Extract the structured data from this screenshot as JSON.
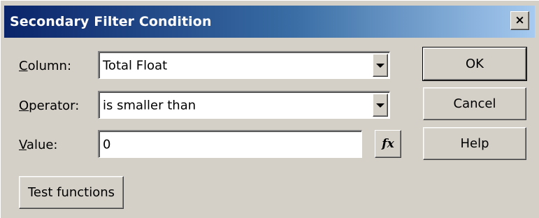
{
  "window": {
    "title": "Secondary Filter Condition",
    "close_glyph": "×"
  },
  "fields": {
    "column": {
      "label_accel": "C",
      "label_rest": "olumn:",
      "value": "Total Float"
    },
    "operator": {
      "label_accel": "O",
      "label_rest": "perator:",
      "value": "is smaller than"
    },
    "value": {
      "label_accel": "V",
      "label_rest": "alue:",
      "value": "0"
    }
  },
  "buttons": {
    "ok": "OK",
    "cancel": "Cancel",
    "help": "Help",
    "test_functions": "Test functions",
    "fx": "fx"
  },
  "icons": {
    "close": "close-icon",
    "dropdown": "chevron-down-icon",
    "function": "function-icon"
  }
}
